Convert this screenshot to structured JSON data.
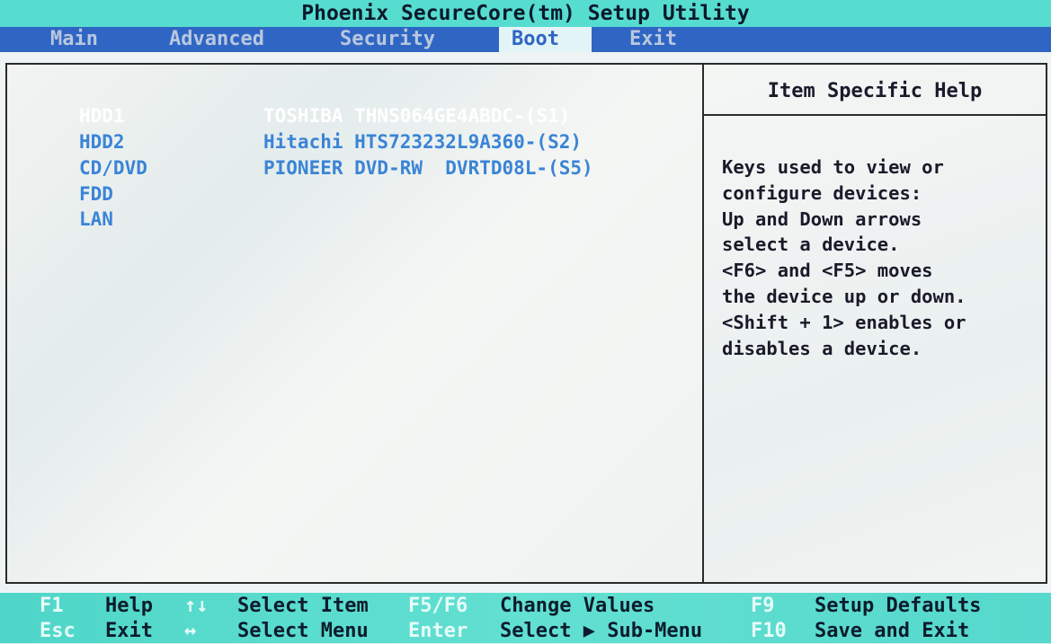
{
  "window": {
    "title": "Phoenix SecureCore(tm) Setup Utility"
  },
  "menu": {
    "tabs": [
      "Main",
      "Advanced",
      "Security",
      "Boot",
      "Exit"
    ],
    "active": "Boot"
  },
  "boot": {
    "devices": [
      {
        "name": "HDD1",
        "desc": "TOSHIBA THNS064GE4ABDC-(S1)",
        "selected": true
      },
      {
        "name": "HDD2",
        "desc": "Hitachi HTS723232L9A360-(S2)",
        "selected": false
      },
      {
        "name": "CD/DVD",
        "desc": "PIONEER DVD-RW  DVRTD08L-(S5)",
        "selected": false
      },
      {
        "name": "FDD",
        "desc": "",
        "selected": false
      },
      {
        "name": "LAN",
        "desc": "",
        "selected": false
      }
    ]
  },
  "help": {
    "title": "Item Specific Help",
    "lines": [
      "Keys used to view or",
      "configure devices:",
      "Up and Down arrows",
      "select a device.",
      "<F6> and <F5> moves",
      "the device up or down.",
      "<Shift + 1> enables or",
      "disables a device."
    ]
  },
  "status": {
    "row1": [
      {
        "key": "F1",
        "desc": "Help"
      },
      {
        "key": "↑↓",
        "desc": "Select Item"
      },
      {
        "key": "F5/F6",
        "desc": "Change Values"
      },
      {
        "key": "F9",
        "desc": "Setup Defaults"
      }
    ],
    "row2": [
      {
        "key": "Esc",
        "desc": "Exit"
      },
      {
        "key": "↔",
        "desc": "Select Menu"
      },
      {
        "key": "Enter",
        "desc": "Select ▶ Sub-Menu"
      },
      {
        "key": "F10",
        "desc": "Save and Exit"
      }
    ]
  },
  "colors": {
    "title_bar": "#57dcd0",
    "menu_bar": "#2f66c4",
    "device_text": "#3a84d6",
    "selected_text": "#ffffff"
  }
}
